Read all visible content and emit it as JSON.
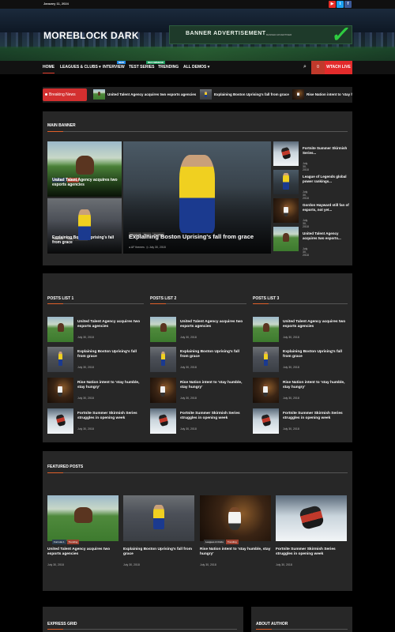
{
  "topbar": {
    "date": "January 11, 2024",
    "social": [
      {
        "icon": "youtube-icon",
        "glyph": "▶",
        "color": "#e52d27"
      },
      {
        "icon": "twitter-icon",
        "glyph": "t",
        "color": "#1da1f2"
      },
      {
        "icon": "facebook-icon",
        "glyph": "f",
        "color": "#3b5998"
      }
    ]
  },
  "header": {
    "logo": "MOREBLOCK DARK",
    "banner": {
      "title": "BANNER ADVERTISEMENT",
      "subtitle": "BANNER ADVERTISER"
    }
  },
  "nav": {
    "items": [
      "HOME",
      "LEAGUES & CLUBS",
      "INTERVIEW",
      "TEST SERIES",
      "TRENDING",
      "ALL DEMOS"
    ],
    "badges": [
      "NEW",
      "RECOMMEND"
    ],
    "zero": "0",
    "watch_live": "WTACH LIVE"
  },
  "breaking": {
    "label": "Breaking News",
    "items": [
      "United Talent Agency acquires two esports agencies",
      "Explaining Boston Uprising's fall from grace",
      "Rise Nation intent to 'stay humble, stay hungry'"
    ]
  },
  "main_banner": {
    "title": "MAIN BANNER",
    "left_top": {
      "tags": [
        "Formula 1",
        "Trending"
      ],
      "title": "United Talent Agency acquires two esports agencies"
    },
    "left_bottom": {
      "tags": [
        "Interview",
        "Team",
        "Trending"
      ],
      "title": "Explaining Boston Uprising's fall from grace"
    },
    "center": {
      "tags": [
        "Interview",
        "Team",
        "Trending"
      ],
      "title": "Explaining Boston Uprising's fall from grace",
      "author": "AF themes",
      "date": "July 30, 2018"
    },
    "side": [
      {
        "title": "Fortnite Summer Skirmish Series...",
        "date": "July 30, 2018"
      },
      {
        "title": "League of Legends global power rankings...",
        "date": "July 30, 2018"
      },
      {
        "title": "Gordon Hayward still fan of esports, not yet...",
        "date": "July 30, 2018"
      },
      {
        "title": "United Talent Agency acquires two esports...",
        "date": "July 30, 2018"
      }
    ]
  },
  "posts_lists": [
    {
      "title": "POSTS LIST 1"
    },
    {
      "title": "POSTS LIST 2"
    },
    {
      "title": "POSTS LIST 3"
    }
  ],
  "posts": [
    {
      "title": "United Talent Agency acquires two esports agencies",
      "date": "July 30, 2018"
    },
    {
      "title": "Explaining Boston Uprising's fall from grace",
      "date": "July 30, 2018"
    },
    {
      "title": "Rise Nation intent to 'stay humble, stay hungry'",
      "date": "July 30, 2018"
    },
    {
      "title": "Fortnite Summer Skirmish Series struggles in opening week",
      "date": "July 30, 2018"
    }
  ],
  "featured": {
    "title": "FEATURED POSTS",
    "items": [
      {
        "title": "United Talent Agency acquires two esports agencies",
        "date": "July 30, 2018",
        "tags": [
          "Formula 1",
          "Trending"
        ]
      },
      {
        "title": "Explaining Boston Uprising's fall from grace",
        "date": "July 30, 2018",
        "tags": []
      },
      {
        "title": "Rise Nation intent to 'stay humble, stay hungry'",
        "date": "July 30, 2018",
        "tags": [
          "Leagues & Clubs",
          "Trending"
        ]
      },
      {
        "title": "Fortnite Summer Skirmish Series struggles in opening week",
        "date": "July 30, 2018",
        "tags": []
      }
    ]
  },
  "bottom": {
    "express_grid": "EXPRESS GRID",
    "about_author": "ABOUT AUTHOR"
  },
  "colors": {
    "accent": "#e0602a",
    "live": "#e32b2b",
    "panel": "#272727",
    "background": "#000000"
  }
}
